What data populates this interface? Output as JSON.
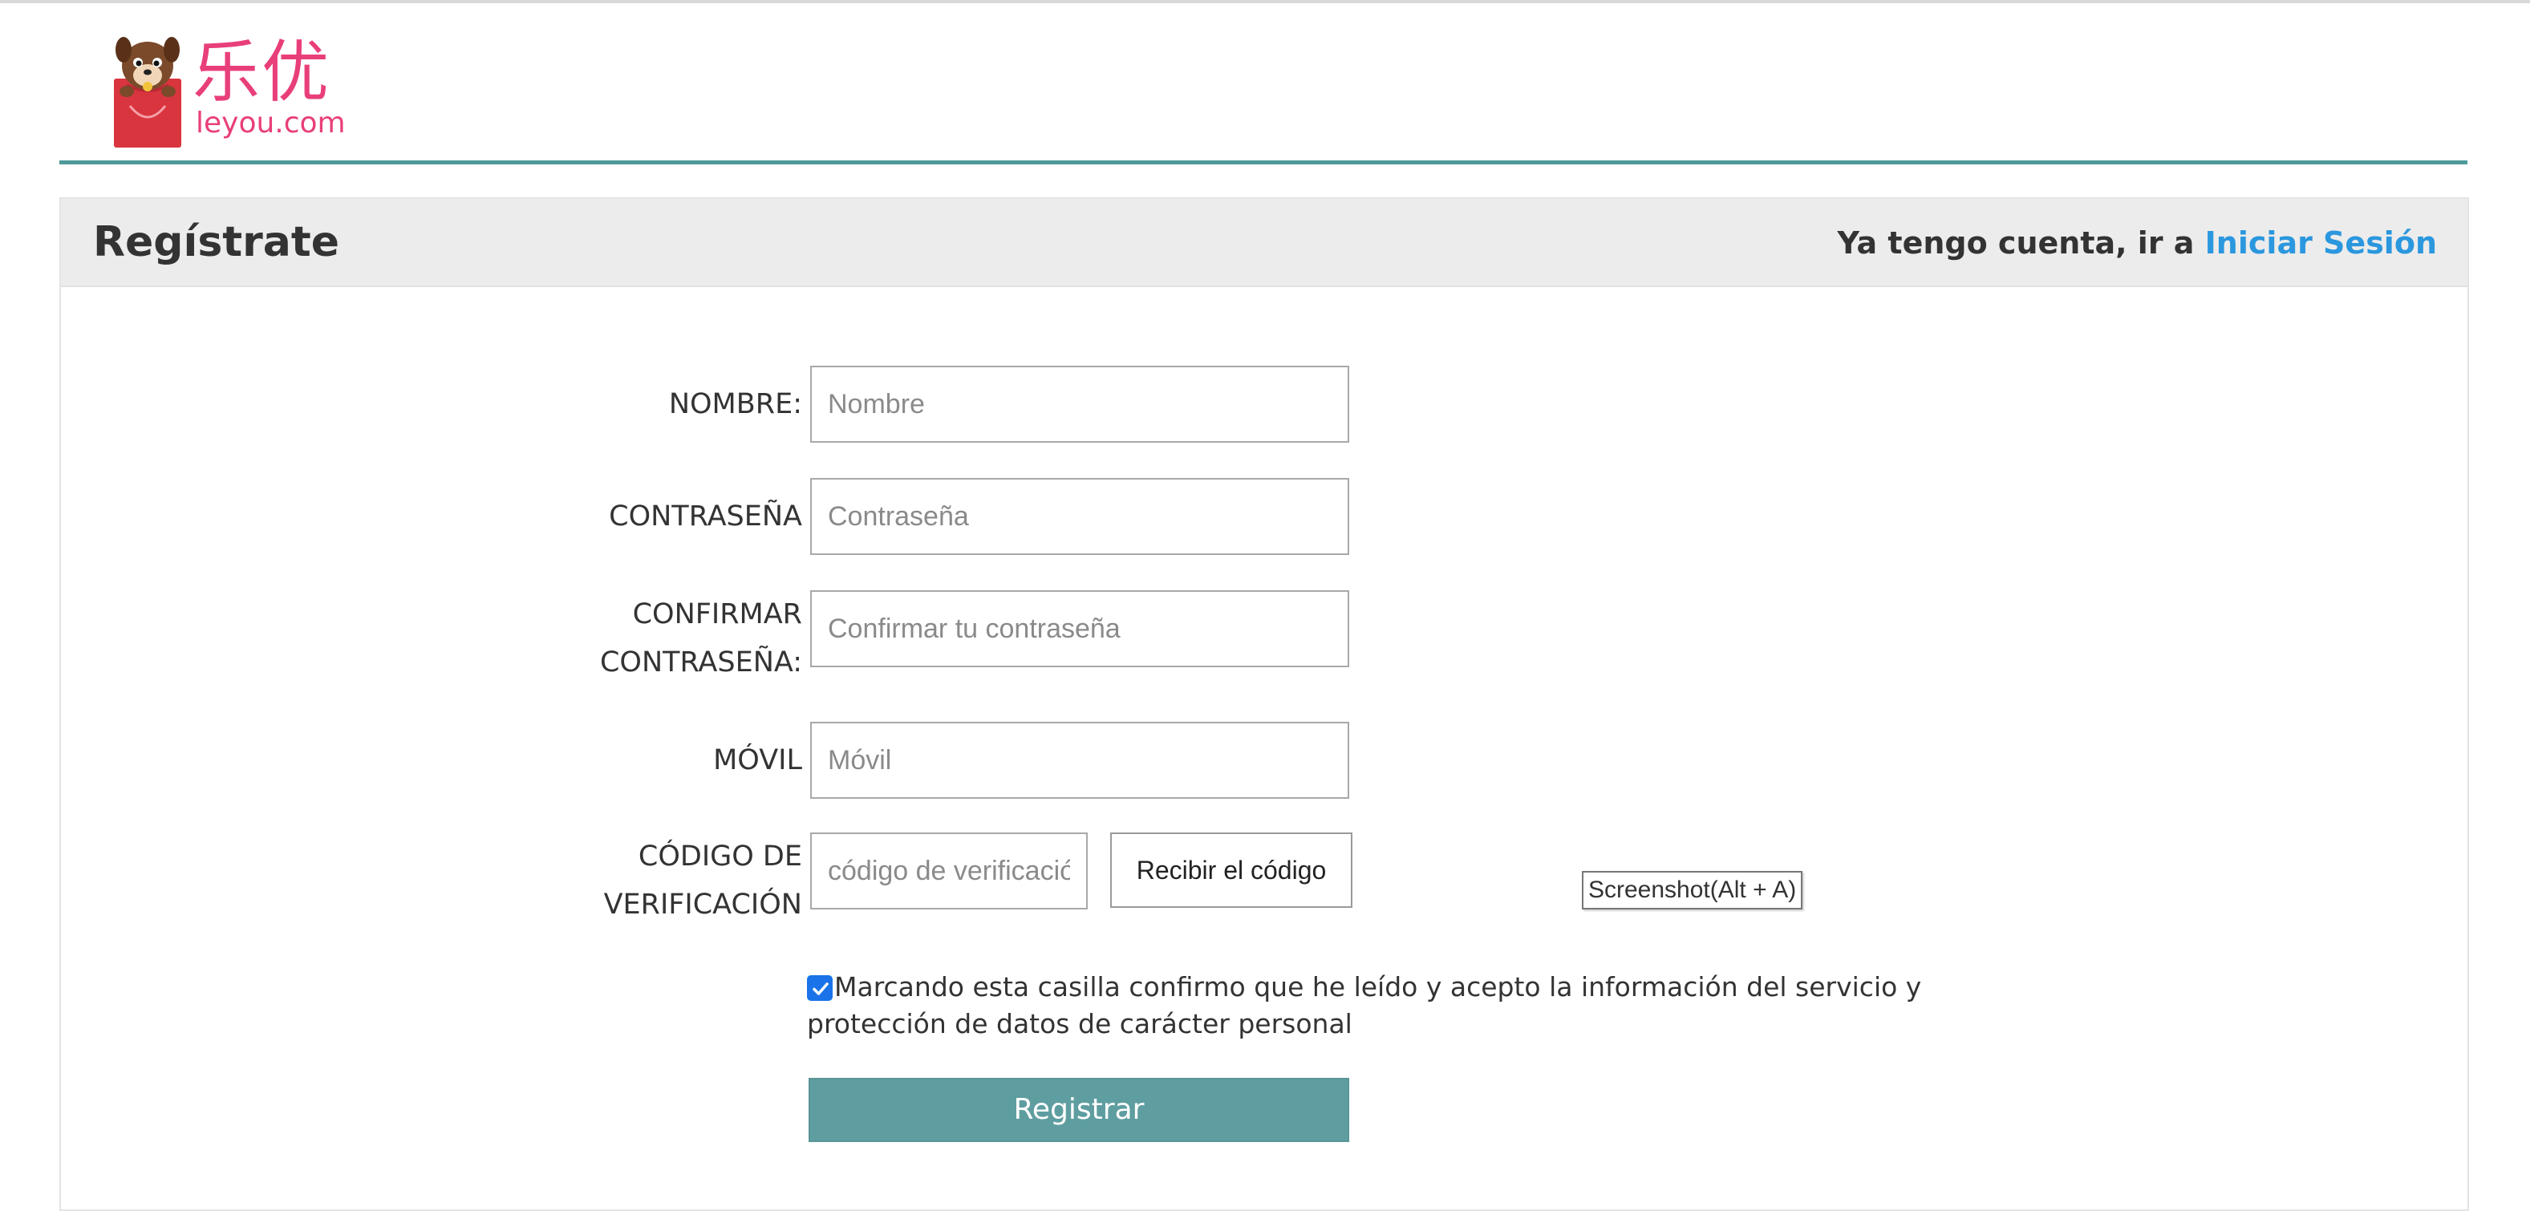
{
  "brand": {
    "chinese_name": "乐优",
    "domain": "leyou.com",
    "mascot_icon": "dog-in-shopping-bag-icon",
    "color": "#e83f7a"
  },
  "register": {
    "title": "Regístrate",
    "login_prompt": "Ya tengo cuenta, ir a ",
    "login_link": "Iniciar Sesión"
  },
  "form": {
    "name_label": "NOMBRE:",
    "name_placeholder": "Nombre",
    "password_label": "CONTRASEÑA",
    "password_placeholder": "Contraseña",
    "confirm_label": "CONFIRMAR CONTRASEÑA:",
    "confirm_placeholder": "Confirmar tu contraseña",
    "mobile_label": "MÓVIL",
    "mobile_placeholder": "Móvil",
    "code_label": "CÓDIGO DE VERIFICACIÓN",
    "code_placeholder": "código de verificación",
    "code_button": "Recibir el código",
    "agree_checked": true,
    "agree_text": "Marcando esta casilla confirmo que he leído y acepto la información del servicio y protección de datos de carácter personal",
    "submit": "Registrar"
  },
  "tooltip": {
    "text": "Screenshot(Alt + A)"
  },
  "colors": {
    "accent_teal": "#5f9ea0",
    "link_blue": "#2b97de",
    "checkbox_blue": "#1a73e8",
    "header_bg": "#ececec"
  }
}
